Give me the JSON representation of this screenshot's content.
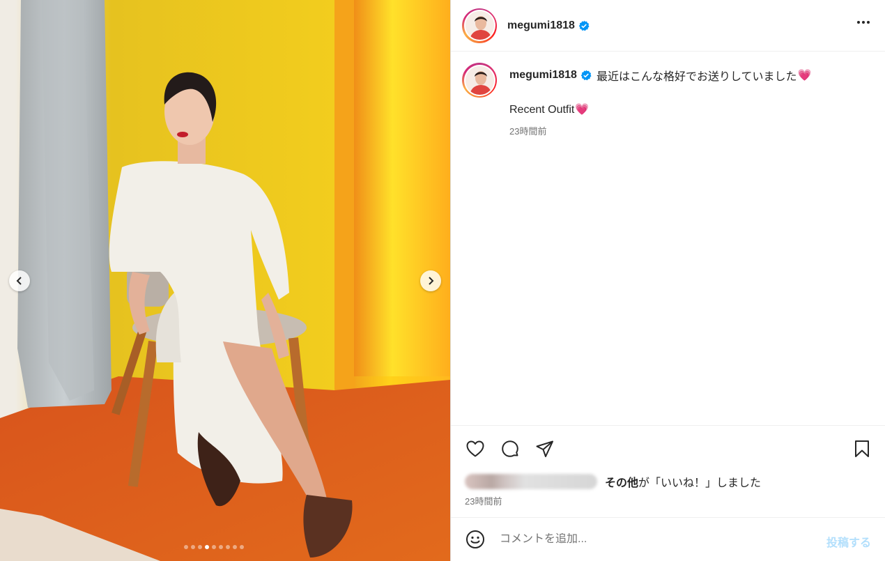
{
  "post": {
    "username": "megumi1818",
    "more_icon": "more-horizontal-icon",
    "verified_icon": "verified-badge-icon",
    "carousel": {
      "slide_count": 9,
      "active_index": 3,
      "prev_icon": "chevron-left-icon",
      "next_icon": "chevron-right-icon"
    },
    "caption": {
      "text": "最近はこんな格好でお送りしていました",
      "emoji": "💗",
      "second_line": "Recent Outfit",
      "second_emoji": "💗",
      "time": "23時間前"
    },
    "actions": {
      "like_icon": "heart-icon",
      "comment_icon": "comment-icon",
      "share_icon": "share-icon",
      "save_icon": "bookmark-icon"
    },
    "likes": {
      "others": "その他",
      "suffix": "が「いいね！」しました",
      "time": "23時間前"
    },
    "comment": {
      "emoji_icon": "emoji-icon",
      "placeholder": "コメントを追加...",
      "post_label": "投稿する"
    }
  },
  "colors": {
    "verified": "#0095f6",
    "post_button_disabled": "#b2dffc",
    "muted_text": "#737373"
  }
}
